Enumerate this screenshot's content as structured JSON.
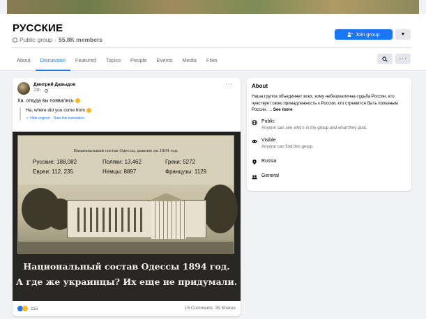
{
  "group": {
    "name": "РУССКИЕ",
    "privacy": "Public group",
    "members": "55.8K members",
    "join_label": "Join group"
  },
  "tabs": [
    "About",
    "Discussion",
    "Featured",
    "Topics",
    "People",
    "Events",
    "Media",
    "Files"
  ],
  "active_tab": "Discussion",
  "post": {
    "author": "Дмитрий Давыдов",
    "time": "23h",
    "text": "Ха. откуда вы появились",
    "translation": "Ha, where did you come from",
    "hide_original": "Hide original",
    "rate_translation": "Rate this translation",
    "photo": {
      "title": "Национальный состав Одессы, данные на 1894 год.",
      "stats": [
        [
          "Русские: 188,082",
          "Поляки: 13,462",
          "Греки: 5272"
        ],
        [
          "Евреи: 112, 235",
          "Немцы: 8897",
          "Французы: 1129"
        ]
      ],
      "caption_line1": "Национальный состав Одессы 1894 год.",
      "caption_line2": "А где же украинцы? Их еще не придумали."
    },
    "reactions_count": "115",
    "comments": "15 Comments",
    "shares": "39 Shares"
  },
  "about": {
    "title": "About",
    "description": "Наша группа объединяет всех, кому небезразлична судьба России, кто чувствует свою принадлежность к России, кто стремится быть полезным России. ...",
    "see_more": "See more",
    "items": [
      {
        "icon": "globe-icon",
        "label": "Public",
        "sub": "Anyone can see who's in the group and what they post."
      },
      {
        "icon": "eye-icon",
        "label": "Visible",
        "sub": "Anyone can find this group."
      },
      {
        "icon": "location-icon",
        "label": "Russia",
        "sub": ""
      },
      {
        "icon": "people-icon",
        "label": "General",
        "sub": ""
      }
    ]
  },
  "colors": {
    "accent": "#1877f2",
    "background": "#f0f2f5"
  }
}
